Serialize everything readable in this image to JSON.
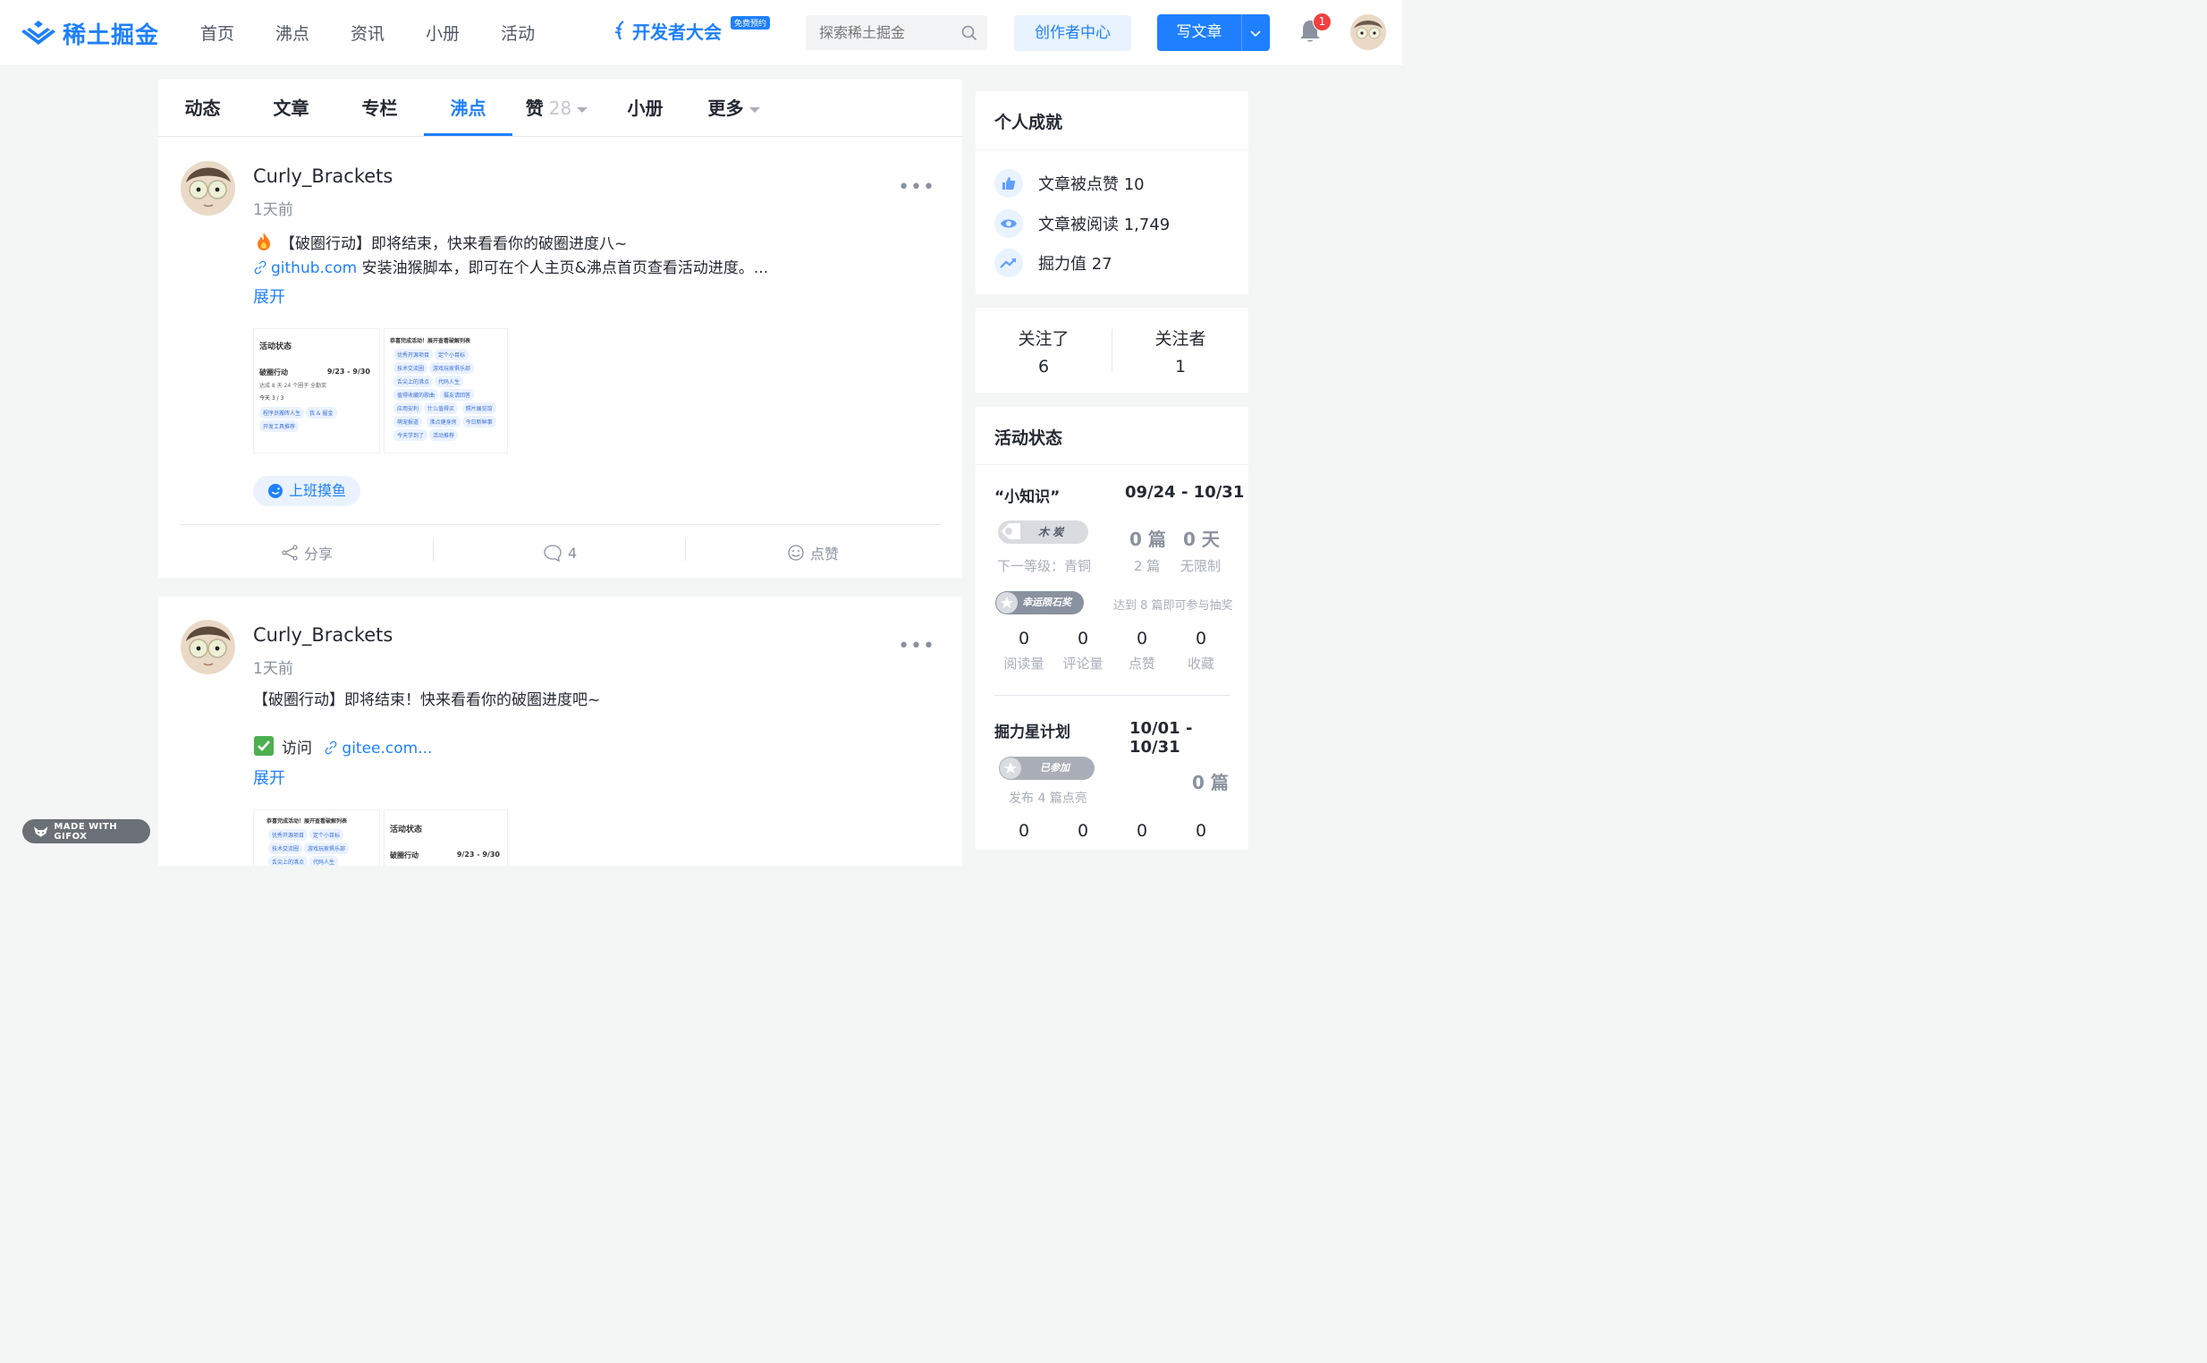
{
  "header": {
    "logo_text": "稀土掘金",
    "nav": [
      "首页",
      "沸点",
      "资讯",
      "小册",
      "活动"
    ],
    "conference_text": "开发者大会",
    "conference_badge": "免费预约",
    "search_placeholder": "探索稀土掘金",
    "creator_button": "创作者中心",
    "write_button": "写文章",
    "notification_count": "1"
  },
  "tabs": {
    "items": [
      "动态",
      "文章",
      "专栏",
      "沸点",
      "赞",
      "小册",
      "更多"
    ],
    "active": "沸点",
    "like_count": "28"
  },
  "posts": [
    {
      "author": "Curly_Brackets",
      "time": "1天前",
      "line1": "【破圈行动】即将结束，快来看看你的破圈进度八~",
      "link_text": "github.com",
      "line2_rest": " 安装油猴脚本，即可在个人主页&沸点首页查看活动进度。...",
      "expand": "展开",
      "topic": "上班摸鱼",
      "actions": {
        "share": "分享",
        "comments": "4",
        "like": "点赞"
      },
      "thumb1": {
        "title": "活动状态",
        "event": "破圈行动",
        "dates": "9/23 - 9/30",
        "progress": "达成 8 天  24 个圈子  全勤奖",
        "today": "今天 3 / 3",
        "chips": [
          "程序员搬砖人生",
          "我 & 掘金",
          "开发工具推荐"
        ]
      },
      "thumb2": {
        "title": "恭喜完成活动！展开查看破解列表",
        "chips": [
          "优秀开源项目",
          "定个小目标",
          "技术交流圈",
          "游戏玩家俱乐部",
          "舌尖上的沸点",
          "代码人生",
          "值得收藏的歌曲",
          "摄友请回答",
          "应用安利",
          "什么值得买",
          "照片展览馆",
          "萌宠报道",
          "沸点健身房",
          "今日新鲜事",
          "今天学到了",
          "活动推荐"
        ]
      }
    },
    {
      "author": "Curly_Brackets",
      "time": "1天前",
      "line1": "【破圈行动】即将结束！快来看看你的破圈进度吧~",
      "visit": "访问",
      "link_text": "gitee.com...",
      "expand": "展开",
      "thumb1": {
        "title": "恭喜完成活动！展开查看破解列表",
        "chips": [
          "优秀开源项目",
          "定个小目标",
          "技术交流圈",
          "游戏玩家俱乐部",
          "舌尖上的沸点",
          "代码人生"
        ]
      },
      "thumb2": {
        "title": "活动状态",
        "event": "破圈行动",
        "dates": "9/23 - 9/30"
      }
    }
  ],
  "achievements": {
    "title": "个人成就",
    "items": [
      {
        "label": "文章被点赞 10",
        "icon": "thumbs-up-icon"
      },
      {
        "label": "文章被阅读 1,749",
        "icon": "eye-icon"
      },
      {
        "label": "掘力值 27",
        "icon": "trend-up-icon"
      }
    ]
  },
  "follow": {
    "following_label": "关注了",
    "following": "6",
    "followers_label": "关注者",
    "followers": "1"
  },
  "activity": {
    "title": "活动状态",
    "event1": {
      "name": "“小知识”",
      "dates": "09/24 - 10/31",
      "level_badge": "木 炭",
      "articles": "0 篇",
      "days": "0 天",
      "next_level": "下一等级：青铜",
      "articles_req": "2 篇",
      "days_req": "无限制",
      "lottery_badge": "幸运陨石奖",
      "lottery_text": "达到 8 篇即可参与抽奖",
      "stats": [
        {
          "value": "0",
          "label": "阅读量"
        },
        {
          "value": "0",
          "label": "评论量"
        },
        {
          "value": "0",
          "label": "点赞"
        },
        {
          "value": "0",
          "label": "收藏"
        }
      ]
    },
    "event2": {
      "name": "掘力星计划",
      "dates": "10/01 - 10/31",
      "joined_badge": "已参加",
      "articles": "0 篇",
      "publish_text": "发布 4 篇点亮",
      "stats": [
        {
          "value": "0"
        },
        {
          "value": "0"
        },
        {
          "value": "0"
        },
        {
          "value": "0"
        }
      ]
    }
  },
  "watermark": "MADE WITH GIFOX"
}
